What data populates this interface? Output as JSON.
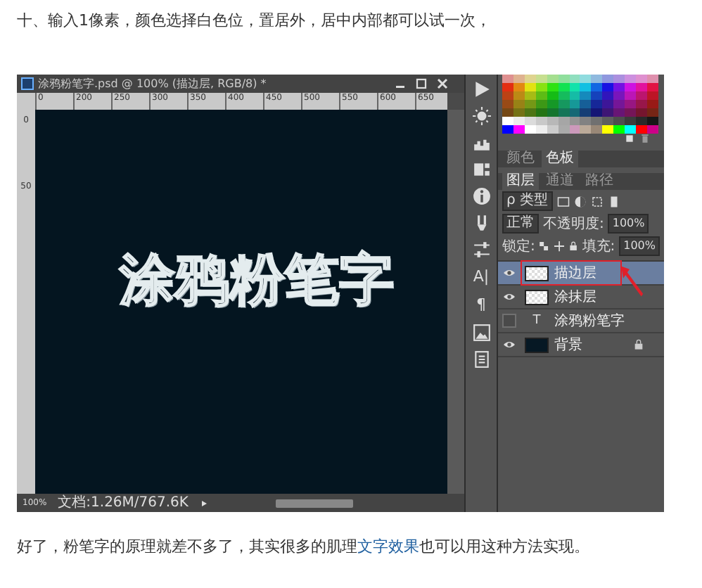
{
  "intro": "十、输入1像素，颜色选择白色位，置居外，居中内部都可以试一次，",
  "editor": {
    "document": {
      "title": "涂鸦粉笔字.psd @ 100% (描边层, RGB/8) *",
      "h_ruler": [
        "0",
        "200",
        "250",
        "300",
        "350",
        "400",
        "450",
        "500",
        "550",
        "600",
        "650"
      ],
      "v_ruler": [
        "0",
        "50"
      ],
      "canvas_text": "涂鸦粉笔字",
      "zoom": "100%",
      "doc_info": "文档:1.26M/767.6K"
    },
    "tools": [
      {
        "kind": "play"
      },
      {
        "kind": "sun"
      },
      {
        "kind": "histogram"
      },
      {
        "kind": "info_panel"
      },
      {
        "kind": "info"
      },
      {
        "kind": "brush"
      },
      {
        "kind": "sliders"
      },
      {
        "kind": "glyph",
        "glyph": "A|"
      },
      {
        "kind": "glyph",
        "glyph": "¶"
      },
      {
        "kind": "image"
      },
      {
        "kind": "document"
      }
    ],
    "swatch_tabs": [
      {
        "label": "颜色",
        "selected": false
      },
      {
        "label": "色板",
        "selected": true
      }
    ],
    "layer_tabs": [
      {
        "label": "图层",
        "selected": true
      },
      {
        "label": "通道",
        "selected": false
      },
      {
        "label": "路径",
        "selected": false
      }
    ],
    "filter": "ρ 类型",
    "blend_mode": "正常",
    "opacity_label": "不透明度:",
    "opacity": "100%",
    "lock_label": "锁定:",
    "fill_label": "填充:",
    "fill": "100%",
    "layers": [
      {
        "name": "描边层",
        "kind": "transparent",
        "visible": true,
        "selected": true,
        "locked": false
      },
      {
        "name": "涂抹层",
        "kind": "transparent",
        "visible": true,
        "selected": false,
        "locked": false
      },
      {
        "name": "涂鸦粉笔字",
        "kind": "text",
        "thumb_glyph": "T",
        "visible": false,
        "selected": false,
        "locked": false
      },
      {
        "name": "背景",
        "kind": "dark",
        "visible": true,
        "selected": false,
        "locked": true
      }
    ]
  },
  "outro": {
    "before": "好了，粉笔字的原理就差不多了，其实很多的肌理",
    "link": "文字效果",
    "after": "也可以用这种方法实现。"
  }
}
